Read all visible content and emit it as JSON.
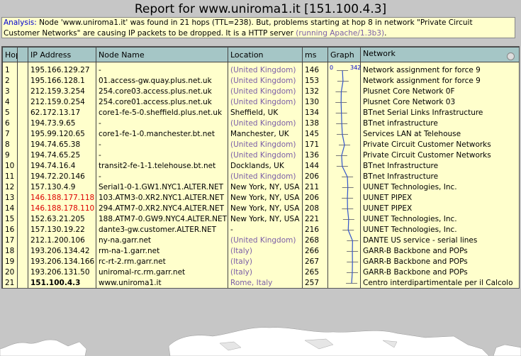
{
  "title": "Report for www.uniroma1.it [151.100.4.3]",
  "analysis": {
    "label": "Analysis:",
    "text1": " Node 'www.uniroma1.it' was found in 21 hops (TTL=238). But, problems starting at hop 8 in network \"Private Circuit",
    "text2": "Customer Networks\" are causing IP packets to be dropped. It is a HTTP server ",
    "server": "(running Apache/1.3b3)",
    "end": "."
  },
  "columns": [
    "Hop",
    "",
    "IP Address",
    "Node Name",
    "Location",
    "ms",
    "Graph",
    "Network"
  ],
  "graph_scale": {
    "min": "0",
    "max": "342"
  },
  "rows": [
    {
      "hop": "1",
      "ip": "195.166.129.27",
      "node": "-",
      "loc": "(United Kingdom)",
      "loc_style": "blue",
      "ms": "146",
      "net": "Network assignment for force 9"
    },
    {
      "hop": "2",
      "ip": "195.166.128.1",
      "node": "01.access-gw.quay.plus.net.uk",
      "loc": "(United Kingdom)",
      "loc_style": "blue",
      "ms": "153",
      "net": "Network assignment for force 9"
    },
    {
      "hop": "3",
      "ip": "212.159.3.254",
      "node": "254.core03.access.plus.net.uk",
      "loc": "(United Kingdom)",
      "loc_style": "blue",
      "ms": "132",
      "net": "Plusnet Core Network 0F"
    },
    {
      "hop": "4",
      "ip": "212.159.0.254",
      "node": "254.core01.access.plus.net.uk",
      "loc": "(United Kingdom)",
      "loc_style": "blue",
      "ms": "130",
      "net": "Plusnet Core Network 03"
    },
    {
      "hop": "5",
      "ip": "62.172.13.17",
      "node": "core1-fe-5-0.sheffield.plus.net.uk",
      "loc": "Sheffield, UK",
      "loc_style": "",
      "ms": "134",
      "net": "BTnet Serial Links Infrastructure"
    },
    {
      "hop": "6",
      "ip": "194.73.9.65",
      "node": "-",
      "loc": "(United Kingdom)",
      "loc_style": "blue",
      "ms": "138",
      "net": "BTnet infrastructure"
    },
    {
      "hop": "7",
      "ip": "195.99.120.65",
      "node": "core1-fe-1-0.manchester.bt.net",
      "loc": "Manchester, UK",
      "loc_style": "",
      "ms": "145",
      "net": "Services LAN at Telehouse"
    },
    {
      "hop": "8",
      "ip": "194.74.65.38",
      "node": "-",
      "loc": "(United Kingdom)",
      "loc_style": "blue",
      "ms": "171",
      "net": "Private Circuit Customer Networks"
    },
    {
      "hop": "9",
      "ip": "194.74.65.25",
      "node": "-",
      "loc": "(United Kingdom)",
      "loc_style": "blue",
      "ms": "136",
      "net": "Private Circuit Customer Networks"
    },
    {
      "hop": "10",
      "ip": "194.74.16.4",
      "node": "transit2-fe-1-1.telehouse.bt.net",
      "loc": "Docklands, UK",
      "loc_style": "",
      "ms": "144",
      "net": "BTnet Infrastructure"
    },
    {
      "hop": "11",
      "ip": "194.72.20.146",
      "node": "-",
      "loc": "(United Kingdom)",
      "loc_style": "blue",
      "ms": "206",
      "net": "BTnet Infrastructure"
    },
    {
      "hop": "12",
      "ip": "157.130.4.9",
      "node": "Serial1-0-1.GW1.NYC1.ALTER.NET",
      "loc": "New York, NY, USA",
      "loc_style": "",
      "ms": "211",
      "net": "UUNET Technologies, Inc."
    },
    {
      "hop": "13",
      "ip": "146.188.177.118",
      "ip_style": "red",
      "node": "103.ATM3-0.XR2.NYC1.ALTER.NET",
      "loc": "New York, NY, USA",
      "loc_style": "",
      "ms": "206",
      "net": "UUNET PIPEX"
    },
    {
      "hop": "14",
      "ip": "146.188.178.110",
      "ip_style": "red",
      "node": "294.ATM7-0.XR2.NYC4.ALTER.NET",
      "loc": "New York, NY, USA",
      "loc_style": "",
      "ms": "208",
      "net": "UUNET PIPEX"
    },
    {
      "hop": "15",
      "ip": "152.63.21.205",
      "node": "188.ATM7-0.GW9.NYC4.ALTER.NET",
      "loc": "New York, NY, USA",
      "loc_style": "",
      "ms": "221",
      "net": "UUNET Technologies, Inc."
    },
    {
      "hop": "16",
      "ip": "157.130.19.22",
      "node": "dante3-gw.customer.ALTER.NET",
      "loc": "-",
      "loc_style": "",
      "ms": "216",
      "net": "UUNET Technologies, Inc."
    },
    {
      "hop": "17",
      "ip": "212.1.200.106",
      "node": "ny-na.garr.net",
      "loc": "(United Kingdom)",
      "loc_style": "blue",
      "ms": "268",
      "net": "DANTE US service - serial lines"
    },
    {
      "hop": "18",
      "ip": "193.206.134.42",
      "node": "rm-na-1.garr.net",
      "loc": "(Italy)",
      "loc_style": "blue",
      "ms": "266",
      "net": "GARR-B Backbone and POPs"
    },
    {
      "hop": "19",
      "ip": "193.206.134.166",
      "node": "rc-rt-2.rm.garr.net",
      "loc": "(Italy)",
      "loc_style": "blue",
      "ms": "267",
      "net": "GARR-B Backbone and POPs"
    },
    {
      "hop": "20",
      "ip": "193.206.131.50",
      "node": "uniromal-rc.rm.garr.net",
      "loc": "(Italy)",
      "loc_style": "blue",
      "ms": "265",
      "net": "GARR-B Backbone and POPs"
    },
    {
      "hop": "21",
      "ip": "151.100.4.3",
      "ip_style": "bold",
      "node": "www.uniroma1.it",
      "loc": "Rome, Italy",
      "loc_style": "blue",
      "ms": "257",
      "net": "Centro interdipartimentale per il Calcolo"
    }
  ]
}
